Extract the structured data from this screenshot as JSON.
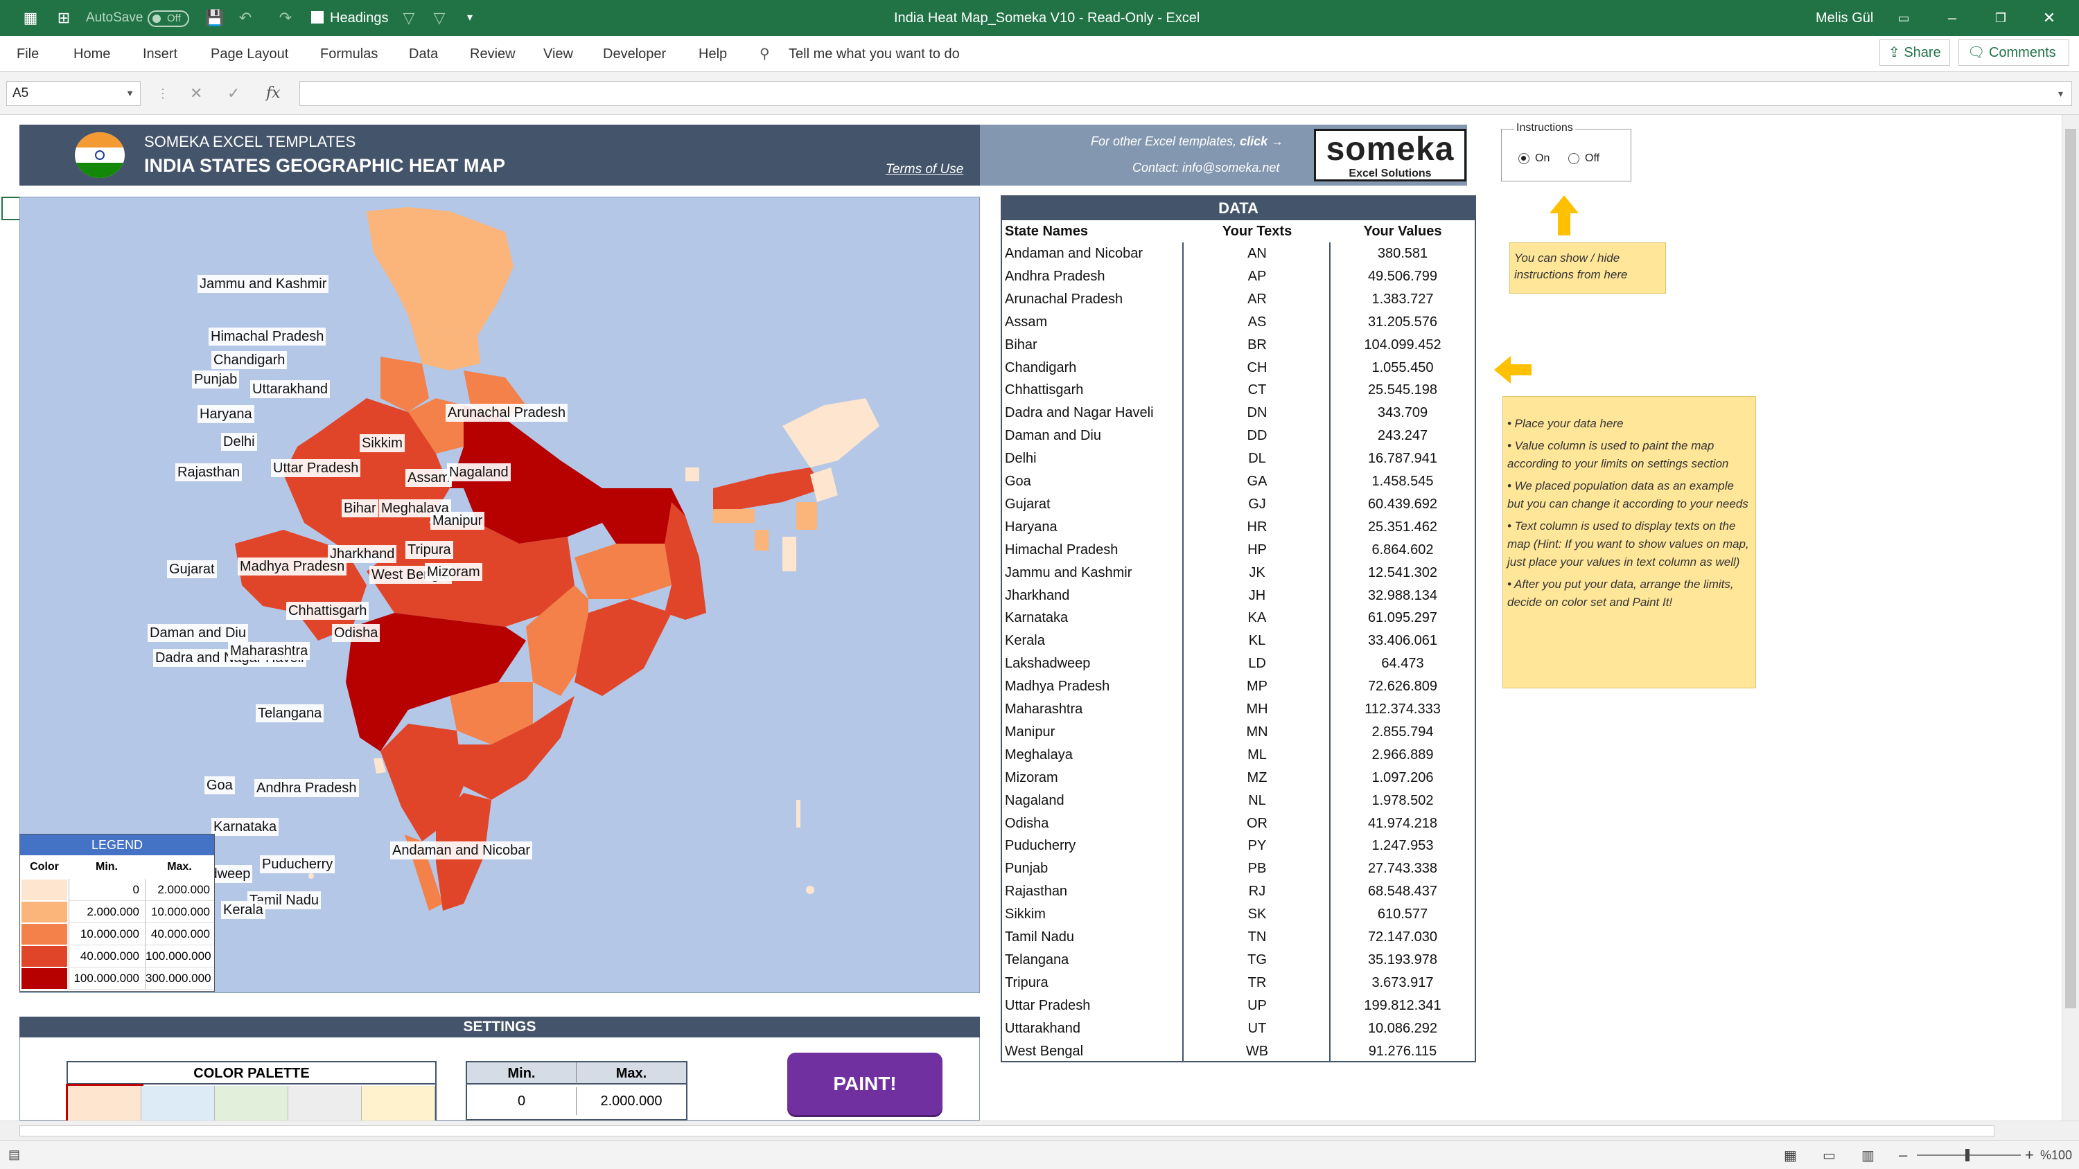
{
  "titlebar": {
    "autosave_label": "AutoSave",
    "autosave_state": "Off",
    "headings_label": "Headings",
    "doc_title": "India Heat Map_Someka V10  -  Read-Only  -  Excel",
    "user": "Melis Gül"
  },
  "ribbon": {
    "tabs": [
      "File",
      "Home",
      "Insert",
      "Page Layout",
      "Formulas",
      "Data",
      "Review",
      "View",
      "Developer",
      "Help"
    ],
    "tell_me": "Tell me what you want to do",
    "share": "Share",
    "comments": "Comments"
  },
  "formula_bar": {
    "name_box": "A5",
    "formula": ""
  },
  "header": {
    "brand": "SOMEKA EXCEL TEMPLATES",
    "title": "INDIA STATES GEOGRAPHIC HEAT MAP",
    "terms": "Terms of Use",
    "other_templates": "For other Excel templates,",
    "click": "click →",
    "contact": "Contact: info@someka.net",
    "logo_big": "someka",
    "logo_small": "Excel Solutions"
  },
  "instructions": {
    "label": "Instructions",
    "on": "On",
    "off": "Off",
    "selected": "On"
  },
  "map": {
    "labels": [
      "Jammu and Kashmir",
      "Himachal Pradesh",
      "Chandigarh",
      "Punjab",
      "Uttarakhand",
      "Haryana",
      "Delhi",
      "Rajasthan",
      "Uttar Pradesh",
      "Sikkim",
      "Arunachal Pradesh",
      "Assam",
      "Nagaland",
      "Bihar",
      "Meghalaya",
      "Manipur",
      "Gujarat",
      "Madhya Pradesh",
      "Jharkhand",
      "Tripura",
      "West Bengal",
      "Mizoram",
      "Chhattisgarh",
      "Daman and Diu",
      "Odisha",
      "Dadra and Nagar Haveli",
      "Maharashtra",
      "Telangana",
      "Goa",
      "Andhra Pradesh",
      "Karnataka",
      "Andaman and Nicobar",
      "Lakshadweep",
      "Puducherry",
      "Tamil Nadu",
      "Kerala"
    ]
  },
  "legend": {
    "title": "LEGEND",
    "col_color": "Color",
    "col_min": "Min.",
    "col_max": "Max.",
    "rows": [
      {
        "min": "0",
        "max": "2.000.000",
        "color": "#fde5cf"
      },
      {
        "min": "2.000.000",
        "max": "10.000.000",
        "color": "#fbb47a"
      },
      {
        "min": "10.000.000",
        "max": "40.000.000",
        "color": "#f4804a"
      },
      {
        "min": "40.000.000",
        "max": "100.000.000",
        "color": "#e0452a"
      },
      {
        "min": "100.000.000",
        "max": "300.000.000",
        "color": "#b70000"
      }
    ]
  },
  "data": {
    "title": "DATA",
    "col_state": "State Names",
    "col_text": "Your Texts",
    "col_value": "Your Values",
    "rows": [
      {
        "name": "Andaman and Nicobar",
        "code": "AN",
        "value": "380.581"
      },
      {
        "name": "Andhra Pradesh",
        "code": "AP",
        "value": "49.506.799"
      },
      {
        "name": "Arunachal Pradesh",
        "code": "AR",
        "value": "1.383.727"
      },
      {
        "name": "Assam",
        "code": "AS",
        "value": "31.205.576"
      },
      {
        "name": "Bihar",
        "code": "BR",
        "value": "104.099.452"
      },
      {
        "name": "Chandigarh",
        "code": "CH",
        "value": "1.055.450"
      },
      {
        "name": "Chhattisgarh",
        "code": "CT",
        "value": "25.545.198"
      },
      {
        "name": "Dadra and Nagar Haveli",
        "code": "DN",
        "value": "343.709"
      },
      {
        "name": "Daman and Diu",
        "code": "DD",
        "value": "243.247"
      },
      {
        "name": "Delhi",
        "code": "DL",
        "value": "16.787.941"
      },
      {
        "name": "Goa",
        "code": "GA",
        "value": "1.458.545"
      },
      {
        "name": "Gujarat",
        "code": "GJ",
        "value": "60.439.692"
      },
      {
        "name": "Haryana",
        "code": "HR",
        "value": "25.351.462"
      },
      {
        "name": "Himachal Pradesh",
        "code": "HP",
        "value": "6.864.602"
      },
      {
        "name": "Jammu and Kashmir",
        "code": "JK",
        "value": "12.541.302"
      },
      {
        "name": "Jharkhand",
        "code": "JH",
        "value": "32.988.134"
      },
      {
        "name": "Karnataka",
        "code": "KA",
        "value": "61.095.297"
      },
      {
        "name": "Kerala",
        "code": "KL",
        "value": "33.406.061"
      },
      {
        "name": "Lakshadweep",
        "code": "LD",
        "value": "64.473"
      },
      {
        "name": "Madhya Pradesh",
        "code": "MP",
        "value": "72.626.809"
      },
      {
        "name": "Maharashtra",
        "code": "MH",
        "value": "112.374.333"
      },
      {
        "name": "Manipur",
        "code": "MN",
        "value": "2.855.794"
      },
      {
        "name": "Meghalaya",
        "code": "ML",
        "value": "2.966.889"
      },
      {
        "name": "Mizoram",
        "code": "MZ",
        "value": "1.097.206"
      },
      {
        "name": "Nagaland",
        "code": "NL",
        "value": "1.978.502"
      },
      {
        "name": "Odisha",
        "code": "OR",
        "value": "41.974.218"
      },
      {
        "name": "Puducherry",
        "code": "PY",
        "value": "1.247.953"
      },
      {
        "name": "Punjab",
        "code": "PB",
        "value": "27.743.338"
      },
      {
        "name": "Rajasthan",
        "code": "RJ",
        "value": "68.548.437"
      },
      {
        "name": "Sikkim",
        "code": "SK",
        "value": "610.577"
      },
      {
        "name": "Tamil Nadu",
        "code": "TN",
        "value": "72.147.030"
      },
      {
        "name": "Telangana",
        "code": "TG",
        "value": "35.193.978"
      },
      {
        "name": "Tripura",
        "code": "TR",
        "value": "3.673.917"
      },
      {
        "name": "Uttar Pradesh",
        "code": "UP",
        "value": "199.812.341"
      },
      {
        "name": "Uttarakhand",
        "code": "UT",
        "value": "10.086.292"
      },
      {
        "name": "West Bengal",
        "code": "WB",
        "value": "91.276.115"
      }
    ]
  },
  "notes": {
    "small": "You can show / hide instructions from here",
    "bullets": [
      "• Place your data here",
      "• Value column is used to paint the map according to your limits on settings section",
      "• We placed population data as an example but you can change it according to your needs",
      "• Text column is used to display texts on the map (Hint: If you want to show values on map, just place your values in text column as well)",
      "• After you put your data, arrange the limits, decide on color set and Paint It!"
    ]
  },
  "settings": {
    "title": "SETTINGS",
    "palette_title": "COLOR PALETTE",
    "palette_colors": [
      "#fde5cf",
      "#ddebf7",
      "#e2efda",
      "#ededed",
      "#fff2cc"
    ],
    "min_label": "Min.",
    "max_label": "Max.",
    "min_value": "0",
    "max_value": "2.000.000",
    "paint": "PAINT!"
  },
  "status": {
    "zoom": "%100"
  },
  "colors": {
    "excel_green": "#217346",
    "header_dark": "#44546a",
    "header_light": "#8497b0",
    "sea": "#b4c7e7",
    "note": "#ffe699",
    "paint": "#7030a0"
  }
}
